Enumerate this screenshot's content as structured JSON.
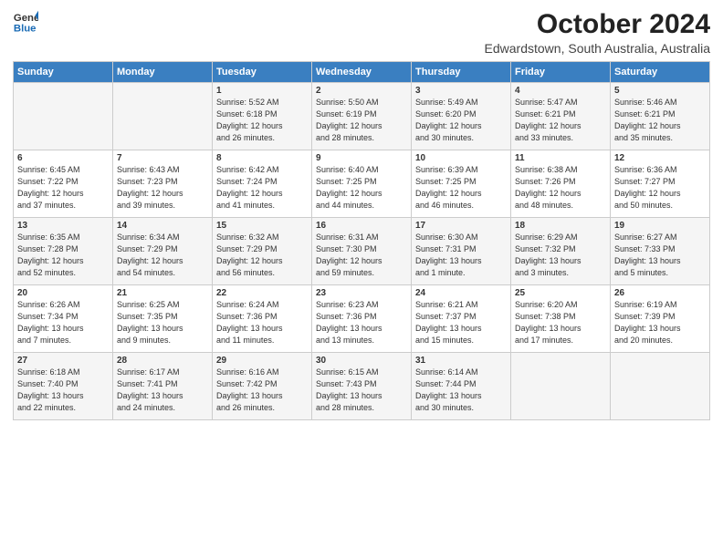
{
  "logo": {
    "line1": "General",
    "line2": "Blue"
  },
  "title": "October 2024",
  "subtitle": "Edwardstown, South Australia, Australia",
  "days_of_week": [
    "Sunday",
    "Monday",
    "Tuesday",
    "Wednesday",
    "Thursday",
    "Friday",
    "Saturday"
  ],
  "weeks": [
    [
      {
        "day": "",
        "info": ""
      },
      {
        "day": "",
        "info": ""
      },
      {
        "day": "1",
        "info": "Sunrise: 5:52 AM\nSunset: 6:18 PM\nDaylight: 12 hours\nand 26 minutes."
      },
      {
        "day": "2",
        "info": "Sunrise: 5:50 AM\nSunset: 6:19 PM\nDaylight: 12 hours\nand 28 minutes."
      },
      {
        "day": "3",
        "info": "Sunrise: 5:49 AM\nSunset: 6:20 PM\nDaylight: 12 hours\nand 30 minutes."
      },
      {
        "day": "4",
        "info": "Sunrise: 5:47 AM\nSunset: 6:21 PM\nDaylight: 12 hours\nand 33 minutes."
      },
      {
        "day": "5",
        "info": "Sunrise: 5:46 AM\nSunset: 6:21 PM\nDaylight: 12 hours\nand 35 minutes."
      }
    ],
    [
      {
        "day": "6",
        "info": "Sunrise: 6:45 AM\nSunset: 7:22 PM\nDaylight: 12 hours\nand 37 minutes."
      },
      {
        "day": "7",
        "info": "Sunrise: 6:43 AM\nSunset: 7:23 PM\nDaylight: 12 hours\nand 39 minutes."
      },
      {
        "day": "8",
        "info": "Sunrise: 6:42 AM\nSunset: 7:24 PM\nDaylight: 12 hours\nand 41 minutes."
      },
      {
        "day": "9",
        "info": "Sunrise: 6:40 AM\nSunset: 7:25 PM\nDaylight: 12 hours\nand 44 minutes."
      },
      {
        "day": "10",
        "info": "Sunrise: 6:39 AM\nSunset: 7:25 PM\nDaylight: 12 hours\nand 46 minutes."
      },
      {
        "day": "11",
        "info": "Sunrise: 6:38 AM\nSunset: 7:26 PM\nDaylight: 12 hours\nand 48 minutes."
      },
      {
        "day": "12",
        "info": "Sunrise: 6:36 AM\nSunset: 7:27 PM\nDaylight: 12 hours\nand 50 minutes."
      }
    ],
    [
      {
        "day": "13",
        "info": "Sunrise: 6:35 AM\nSunset: 7:28 PM\nDaylight: 12 hours\nand 52 minutes."
      },
      {
        "day": "14",
        "info": "Sunrise: 6:34 AM\nSunset: 7:29 PM\nDaylight: 12 hours\nand 54 minutes."
      },
      {
        "day": "15",
        "info": "Sunrise: 6:32 AM\nSunset: 7:29 PM\nDaylight: 12 hours\nand 56 minutes."
      },
      {
        "day": "16",
        "info": "Sunrise: 6:31 AM\nSunset: 7:30 PM\nDaylight: 12 hours\nand 59 minutes."
      },
      {
        "day": "17",
        "info": "Sunrise: 6:30 AM\nSunset: 7:31 PM\nDaylight: 13 hours\nand 1 minute."
      },
      {
        "day": "18",
        "info": "Sunrise: 6:29 AM\nSunset: 7:32 PM\nDaylight: 13 hours\nand 3 minutes."
      },
      {
        "day": "19",
        "info": "Sunrise: 6:27 AM\nSunset: 7:33 PM\nDaylight: 13 hours\nand 5 minutes."
      }
    ],
    [
      {
        "day": "20",
        "info": "Sunrise: 6:26 AM\nSunset: 7:34 PM\nDaylight: 13 hours\nand 7 minutes."
      },
      {
        "day": "21",
        "info": "Sunrise: 6:25 AM\nSunset: 7:35 PM\nDaylight: 13 hours\nand 9 minutes."
      },
      {
        "day": "22",
        "info": "Sunrise: 6:24 AM\nSunset: 7:36 PM\nDaylight: 13 hours\nand 11 minutes."
      },
      {
        "day": "23",
        "info": "Sunrise: 6:23 AM\nSunset: 7:36 PM\nDaylight: 13 hours\nand 13 minutes."
      },
      {
        "day": "24",
        "info": "Sunrise: 6:21 AM\nSunset: 7:37 PM\nDaylight: 13 hours\nand 15 minutes."
      },
      {
        "day": "25",
        "info": "Sunrise: 6:20 AM\nSunset: 7:38 PM\nDaylight: 13 hours\nand 17 minutes."
      },
      {
        "day": "26",
        "info": "Sunrise: 6:19 AM\nSunset: 7:39 PM\nDaylight: 13 hours\nand 20 minutes."
      }
    ],
    [
      {
        "day": "27",
        "info": "Sunrise: 6:18 AM\nSunset: 7:40 PM\nDaylight: 13 hours\nand 22 minutes."
      },
      {
        "day": "28",
        "info": "Sunrise: 6:17 AM\nSunset: 7:41 PM\nDaylight: 13 hours\nand 24 minutes."
      },
      {
        "day": "29",
        "info": "Sunrise: 6:16 AM\nSunset: 7:42 PM\nDaylight: 13 hours\nand 26 minutes."
      },
      {
        "day": "30",
        "info": "Sunrise: 6:15 AM\nSunset: 7:43 PM\nDaylight: 13 hours\nand 28 minutes."
      },
      {
        "day": "31",
        "info": "Sunrise: 6:14 AM\nSunset: 7:44 PM\nDaylight: 13 hours\nand 30 minutes."
      },
      {
        "day": "",
        "info": ""
      },
      {
        "day": "",
        "info": ""
      }
    ]
  ]
}
